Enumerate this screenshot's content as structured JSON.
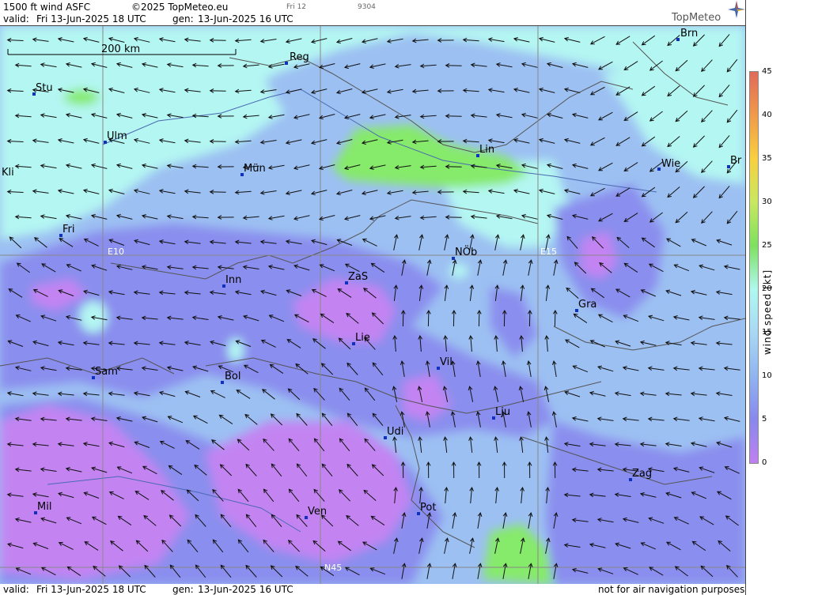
{
  "header": {
    "product": "1500 ft wind ASFC",
    "copyright": "©2025 TopMeteo.eu",
    "daycode": "Fri 12",
    "code": "9304",
    "valid_label": "valid:",
    "valid_time": "Fri 13-Jun-2025 18 UTC",
    "gen_label": "gen:",
    "gen_time": "13-Jun-2025 16 UTC",
    "logo": "TopMeteo",
    "logo_icon": "compass-star-icon"
  },
  "map": {
    "scale_label": "200 km",
    "grid_labels": [
      "E10",
      "E15",
      "N45"
    ],
    "cities": [
      {
        "name": "Brn"
      },
      {
        "name": "Reg"
      },
      {
        "name": "Stu"
      },
      {
        "name": "Ulm"
      },
      {
        "name": "Kli"
      },
      {
        "name": "Lin"
      },
      {
        "name": "Wie"
      },
      {
        "name": "Br"
      },
      {
        "name": "Mün"
      },
      {
        "name": "Fri"
      },
      {
        "name": "NÖb"
      },
      {
        "name": "Inn"
      },
      {
        "name": "ZaS"
      },
      {
        "name": "Gra"
      },
      {
        "name": "Lie"
      },
      {
        "name": "Vil"
      },
      {
        "name": "Sam"
      },
      {
        "name": "Bol"
      },
      {
        "name": "Lju"
      },
      {
        "name": "Udi"
      },
      {
        "name": "Zag"
      },
      {
        "name": "Mil"
      },
      {
        "name": "Ven"
      },
      {
        "name": "Pot"
      }
    ]
  },
  "legend": {
    "title": "wind speed [kt]",
    "ticks": [
      "45",
      "40",
      "35",
      "30",
      "25",
      "20",
      "15",
      "10",
      "5",
      "0"
    ],
    "colors": [
      "#e06a5a",
      "#f09a4a",
      "#f8d040",
      "#c8e860",
      "#7ee060",
      "#b0f8f0",
      "#a8d8f4",
      "#90b4f0",
      "#8888ec",
      "#c080f0"
    ]
  },
  "footer": {
    "valid_label": "valid:",
    "valid_time": "Fri 13-Jun-2025 18 UTC",
    "gen_label": "gen:",
    "gen_time": "13-Jun-2025 16 UTC",
    "disclaimer": "not for air navigation purposes"
  }
}
